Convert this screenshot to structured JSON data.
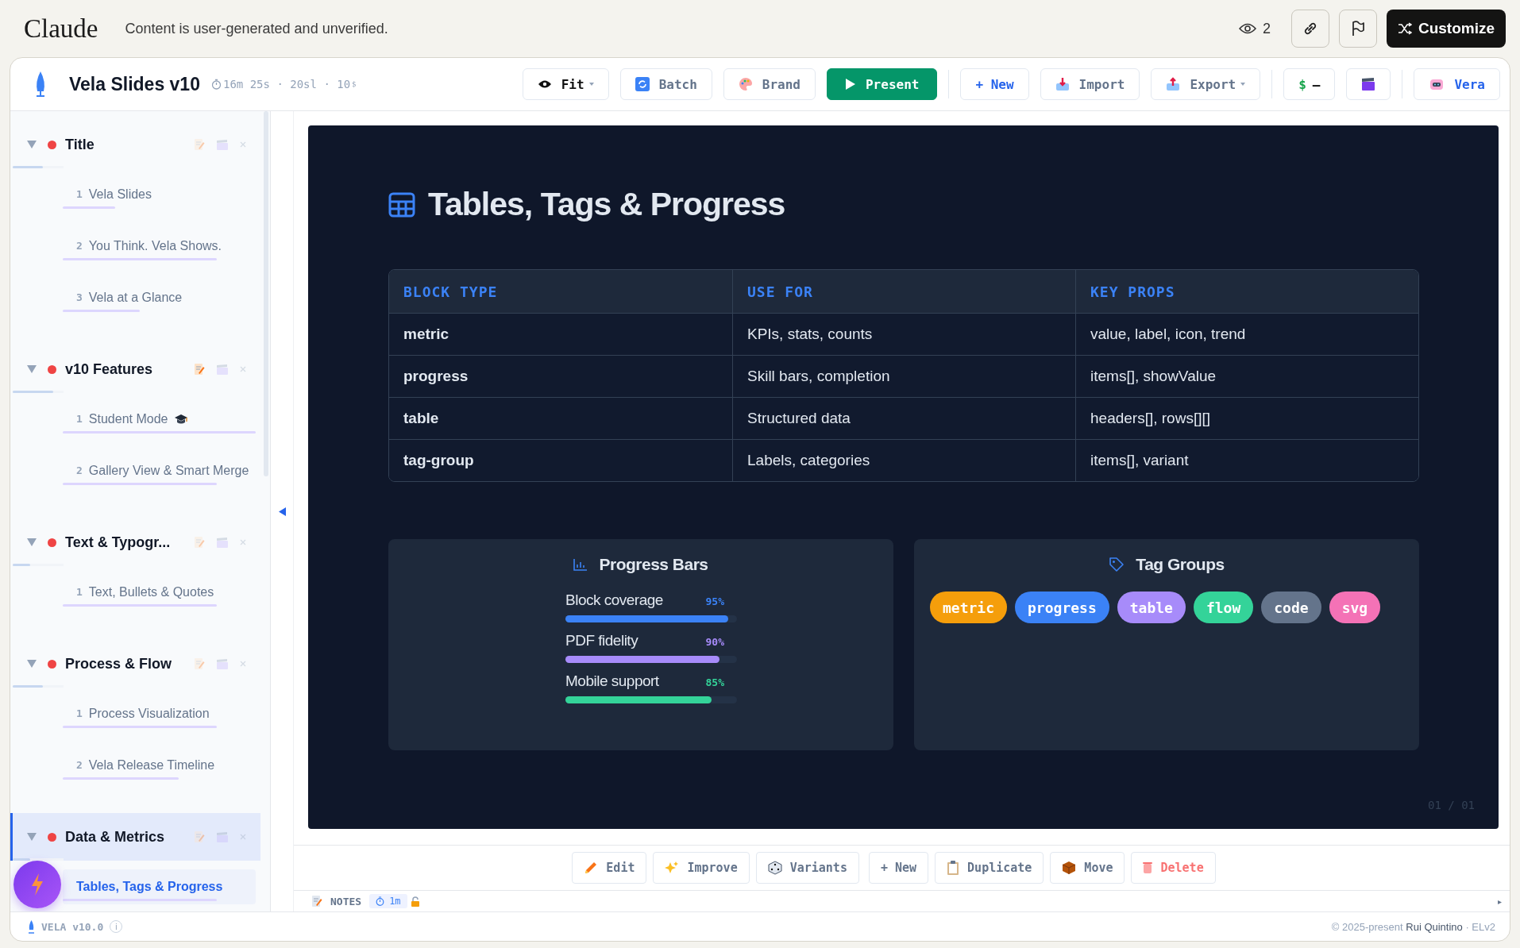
{
  "header": {
    "logo": "Claude",
    "notice": "Content is user-generated and unverified.",
    "viewers": "2",
    "customize": "Customize"
  },
  "toolbar": {
    "title": "Vela Slides v10",
    "meta": "16m 25s · 20sl · 10",
    "meta_sup": "$",
    "groups": [
      {
        "buttons": [
          {
            "label": "Fit",
            "kind": "dark",
            "menu": true
          },
          {
            "label": "Batch",
            "kind": "muted",
            "menu": false
          },
          {
            "label": "Brand",
            "kind": "muted",
            "menu": false
          },
          {
            "label": "Present",
            "kind": "primary",
            "menu": false
          }
        ]
      },
      {
        "buttons": [
          {
            "label": "+ New",
            "kind": "accent",
            "menu": false
          },
          {
            "label": "Import",
            "kind": "muted",
            "menu": false
          },
          {
            "label": "Export",
            "kind": "muted",
            "menu": true
          }
        ]
      },
      {
        "buttons": [
          {
            "prefix": "$",
            "label": "—",
            "kind": "dark",
            "menu": false
          },
          {
            "kind": "muted",
            "menu": false
          }
        ]
      },
      {
        "buttons": [
          {
            "label": "Vera",
            "kind": "accent",
            "menu": false
          }
        ]
      }
    ]
  },
  "sidebar": {
    "sections": [
      {
        "title": "Title",
        "expanded": true,
        "selected": false,
        "notes": false,
        "level": 0.6,
        "items": [
          {
            "num": "1",
            "label": "Vela Slides",
            "selected": false,
            "level": 0.27
          },
          {
            "num": "2",
            "label": "You Think. Vela Shows.",
            "selected": false,
            "level": 0.8
          },
          {
            "num": "3",
            "label": "Vela at a Glance",
            "selected": false,
            "level": 0.4
          }
        ]
      },
      {
        "title": "v10 Features",
        "expanded": true,
        "selected": false,
        "notes": true,
        "level": 0.8,
        "items": [
          {
            "num": "1",
            "label": "Student Mode",
            "selected": false,
            "level": 1.0
          },
          {
            "num": "2",
            "label": "Gallery View & Smart Merge",
            "selected": false,
            "level": 0.8
          }
        ]
      },
      {
        "title": "Text & Typogr...",
        "expanded": true,
        "selected": false,
        "notes": false,
        "level": 0.35,
        "items": [
          {
            "num": "1",
            "label": "Text, Bullets & Quotes",
            "selected": false,
            "level": 0.8
          }
        ]
      },
      {
        "title": "Process & Flow",
        "expanded": true,
        "selected": false,
        "notes": false,
        "level": 0.6,
        "items": [
          {
            "num": "1",
            "label": "Process Visualization",
            "selected": false,
            "level": 0.8
          },
          {
            "num": "2",
            "label": "Vela Release Timeline",
            "selected": false,
            "level": 0.6
          }
        ]
      },
      {
        "title": "Data & Metrics",
        "expanded": true,
        "selected": true,
        "notes": false,
        "level": 0.35,
        "items": [
          {
            "label": "Tables, Tags & Progress",
            "selected": true,
            "level": 0.8
          }
        ]
      }
    ],
    "version": "VELA v10.0",
    "info": "i"
  },
  "slide": {
    "title": "Tables, Tags & Progress",
    "table": {
      "columns": [
        "BLOCK TYPE",
        "USE FOR",
        "KEY PROPS"
      ],
      "rows": [
        [
          "metric",
          "KPIs, stats, counts",
          "value, label, icon, trend"
        ],
        [
          "progress",
          "Skill bars, completion",
          "items[], showValue"
        ],
        [
          "table",
          "Structured data",
          "headers[], rows[][]"
        ],
        [
          "tag-group",
          "Labels, categories",
          "items[], variant"
        ]
      ]
    },
    "progress": {
      "title": "Progress Bars",
      "items": [
        {
          "label": "Block coverage",
          "value": "95%",
          "level": 0.95,
          "color": "#3b82f6"
        },
        {
          "label": "PDF fidelity",
          "value": "90%",
          "level": 0.9,
          "color": "#a78bfa"
        },
        {
          "label": "Mobile support",
          "value": "85%",
          "level": 0.85,
          "color": "#34d399"
        }
      ]
    },
    "tags": {
      "title": "Tag Groups",
      "items": [
        {
          "label": "metric",
          "color": "#f59e0b"
        },
        {
          "label": "progress",
          "color": "#3b82f6"
        },
        {
          "label": "table",
          "color": "#a78bfa"
        },
        {
          "label": "flow",
          "color": "#34d399"
        },
        {
          "label": "code",
          "color": "#64748b"
        },
        {
          "label": "svg",
          "color": "#f472b6"
        }
      ]
    },
    "page": "01 / 01"
  },
  "actions": [
    {
      "label": "Edit",
      "kind": "normal"
    },
    {
      "label": "Improve",
      "kind": "normal"
    },
    {
      "label": "Variants",
      "kind": "normal"
    },
    {
      "label": "+ New",
      "kind": "normal"
    },
    {
      "label": "Duplicate",
      "kind": "normal"
    },
    {
      "label": "Move",
      "kind": "normal"
    },
    {
      "label": "Delete",
      "kind": "danger"
    }
  ],
  "notes": {
    "label": "NOTES",
    "timer": "1m",
    "expand": "▸"
  },
  "footer": {
    "prefix": "© 2025-present",
    "author": "Rui Quintino",
    "suffix": "· ELv2"
  }
}
